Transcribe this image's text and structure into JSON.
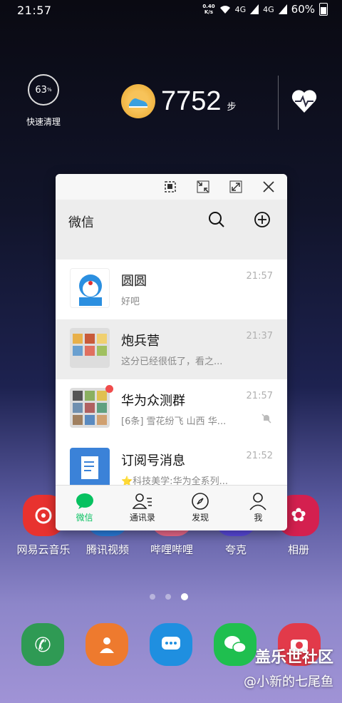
{
  "status_bar": {
    "time": "21:57",
    "net_speed_value": "0.40",
    "net_speed_unit": "K/s",
    "signal1": "4G",
    "signal2": "4G",
    "battery": "60%"
  },
  "widgets": {
    "cleaner": {
      "value": "63",
      "unit": "%",
      "label": "快速清理"
    },
    "steps": {
      "count": "7752",
      "unit": "步"
    }
  },
  "popup": {
    "app_title": "微信",
    "chats": [
      {
        "name": "圆圆",
        "preview": "好吧",
        "time": "21:57",
        "pinned": false
      },
      {
        "name": "炮兵营",
        "preview": "这分已经很低了，看之...",
        "time": "21:37",
        "pinned": true
      },
      {
        "name": "华为众测群",
        "preview": "[6条] 雪花纷飞 山西 华...",
        "time": "21:57",
        "pinned": false,
        "muted": true,
        "unread_dot": true
      },
      {
        "name": "订阅号消息",
        "preview": "⭐科技美学:华为全系列...",
        "time": "21:52",
        "pinned": false
      }
    ],
    "tabs": [
      "微信",
      "通讯录",
      "发现",
      "我"
    ]
  },
  "apps": [
    {
      "label": "网易云音乐",
      "color": "#e8322f"
    },
    {
      "label": "腾讯视频",
      "color": "#2a7fe0"
    },
    {
      "label": "哔哩哔哩",
      "color": "#f06a8c"
    },
    {
      "label": "夸克",
      "color": "#5a4ae0"
    },
    {
      "label": "相册",
      "color": "#d4204f"
    }
  ],
  "dock_colors": [
    "#2f9a54",
    "#ee7a2e",
    "#1f8fe0",
    "#1fbf4f",
    "#e23a4a"
  ],
  "watermark": {
    "line1": "盖乐世社区",
    "line2": "@小新的七尾鱼"
  }
}
